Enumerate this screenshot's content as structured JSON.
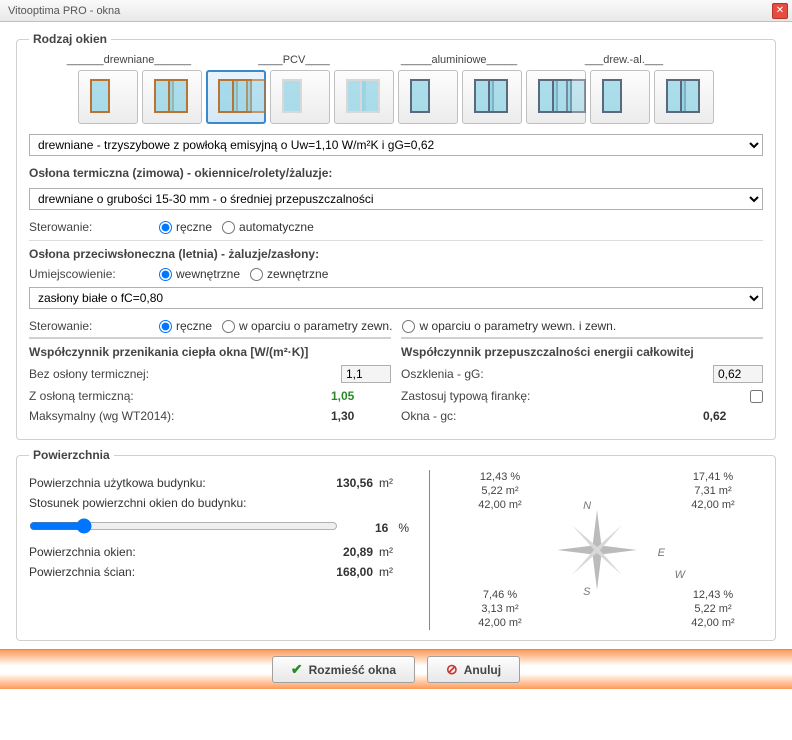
{
  "window_title": "Vitooptima PRO - okna",
  "windowtype_group": {
    "legend": "Rodzaj okien",
    "categories": [
      "drewniane",
      "PCV",
      "aluminiowe",
      "drew.-al."
    ],
    "selected_index": 2,
    "selected_label": "drewniane - trzyszybowe z powłoką emisyjną o Uw=1,10 W/m²K i gG=0,62"
  },
  "thermal_cover": {
    "title": "Osłona termiczna (zimowa) - okiennice/rolety/żaluzje:",
    "dropdown": "drewniane o grubości 15-30 mm - o średniej przepuszczalności",
    "control_label": "Sterowanie:",
    "control_opts": [
      "ręczne",
      "automatyczne"
    ],
    "control_sel": 0
  },
  "sun_cover": {
    "title": "Osłona przeciwsłoneczna (letnia) - żaluzje/zasłony:",
    "loc_label": "Umiejscowienie:",
    "loc_opts": [
      "wewnętrzne",
      "zewnętrzne"
    ],
    "loc_sel": 0,
    "dropdown": "zasłony białe o fC=0,80",
    "control_label": "Sterowanie:",
    "control_opts": [
      "ręczne",
      "w oparciu o parametry zewn.",
      "w oparciu o parametry wewn. i zewn."
    ],
    "control_sel": 0
  },
  "ucoeff": {
    "title": "Współczynnik przenikania ciepła okna [W/(m²·K)]",
    "rows": {
      "no_cover_label": "Bez osłony termicznej:",
      "no_cover_value": "1,1",
      "with_cover_label": "Z osłoną termiczną:",
      "with_cover_value": "1,05",
      "max_label": "Maksymalny (wg WT2014):",
      "max_value": "1,30"
    }
  },
  "gcoeff": {
    "title": "Współczynnik przepuszczalności energii całkowitej",
    "rows": {
      "glazing_label": "Oszklenia - gG:",
      "glazing_value": "0,62",
      "curtain_label": "Zastosuj typową firankę:",
      "window_label": "Okna - gc:",
      "window_value": "0,62"
    }
  },
  "surface": {
    "legend": "Powierzchnia",
    "usable_label": "Powierzchnia użytkowa budynku:",
    "usable_value": "130,56",
    "ratio_label": "Stosunek powierzchni okien do budynku:",
    "ratio_value": "16",
    "windows_area_label": "Powierzchnia okien:",
    "windows_area_value": "20,89",
    "walls_area_label": "Powierzchnia ścian:",
    "walls_area_value": "168,00",
    "unit_m2": "m²",
    "unit_pct": "%",
    "dirs": {
      "n": {
        "pct": "12,43 %",
        "glass": "5,22 m²",
        "wall": "42,00 m²"
      },
      "e": {
        "pct": "17,41 %",
        "glass": "7,31 m²",
        "wall": "42,00 m²"
      },
      "w": {
        "pct": "7,46 %",
        "glass": "3,13 m²",
        "wall": "42,00 m²"
      },
      "s": {
        "pct": "12,43 %",
        "glass": "5,22 m²",
        "wall": "42,00 m²"
      }
    }
  },
  "buttons": {
    "ok": "Rozmieść okna",
    "cancel": "Anuluj"
  }
}
